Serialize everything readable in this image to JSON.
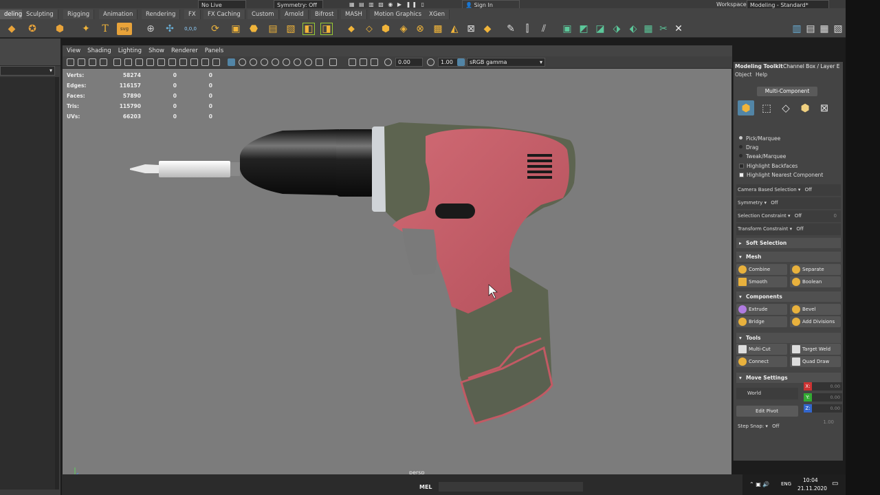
{
  "status_strip": {
    "live_surface": "No Live Surface",
    "symmetry": "Symmetry: Off",
    "sign_in": "Sign In",
    "workspace_label": "Workspace :",
    "workspace_value": "Modeling - Standard*"
  },
  "shelf_tabs": [
    "deling",
    "Sculpting",
    "Rigging",
    "Animation",
    "Rendering",
    "FX",
    "FX Caching",
    "Custom",
    "Arnold",
    "Bifrost",
    "MASH",
    "Motion Graphics",
    "XGen"
  ],
  "shelf_icons": {
    "svg_label": "svg",
    "text_label": "T",
    "coords_label": "0,0,0"
  },
  "viewport": {
    "menu": [
      "View",
      "Shading",
      "Lighting",
      "Show",
      "Renderer",
      "Panels"
    ],
    "field_exposure": "0.00",
    "field_gamma": "1.00",
    "color_space": "sRGB gamma",
    "hud": [
      {
        "label": "Verts:",
        "value": "58274",
        "a": "0",
        "b": "0"
      },
      {
        "label": "Edges:",
        "value": "116157",
        "a": "0",
        "b": "0"
      },
      {
        "label": "Faces:",
        "value": "57890",
        "a": "0",
        "b": "0"
      },
      {
        "label": "Tris:",
        "value": "115790",
        "a": "0",
        "b": "0"
      },
      {
        "label": "UVs:",
        "value": "66203",
        "a": "0",
        "b": "0"
      }
    ],
    "camera": "persp"
  },
  "right_panel": {
    "tab_modeling": "Modeling Toolkit",
    "tab_channel": "Channel Box / Layer E",
    "sub_object": "Object",
    "sub_help": "Help",
    "multi_component": "Multi-Component",
    "pick_marquee": "Pick/Marquee",
    "drag": "Drag",
    "tweak_marquee": "Tweak/Marquee",
    "highlight_backfaces": "Highlight Backfaces",
    "highlight_nearest": "Highlight Nearest Component",
    "camera_based": "Camera Based Selection",
    "camera_based_val": "Off",
    "symmetry": "Symmetry",
    "symmetry_val": "Off",
    "selection_constraint": "Selection Constraint",
    "selection_constraint_val": "Off",
    "selection_constraint_num": "0",
    "transform_constraint": "Transform Constraint",
    "transform_constraint_val": "Off",
    "soft_selection": "Soft Selection",
    "mesh": "Mesh",
    "combine": "Combine",
    "separate": "Separate",
    "smooth": "Smooth",
    "boolean": "Boolean",
    "components": "Components",
    "extrude": "Extrude",
    "bevel": "Bevel",
    "bridge": "Bridge",
    "add_divisions": "Add Divisions",
    "tools": "Tools",
    "multi_cut": "Multi-Cut",
    "target_weld": "Target Weld",
    "connect": "Connect",
    "quad_draw": "Quad Draw",
    "move_settings": "Move Settings",
    "world": "World",
    "edit_pivot": "Edit Pivot",
    "x_label": "X:",
    "y_label": "Y:",
    "z_label": "Z:",
    "x_val": "0.00",
    "y_val": "0.00",
    "z_val": "0.00",
    "step_snap": "Step Snap:",
    "step_snap_val": "Off",
    "step_snap_num": "1.00"
  },
  "bottom": {
    "mel": "MEL",
    "lang": "ENG",
    "time": "10:04",
    "date": "21.11.2020"
  },
  "colors": {
    "accent_blue": "#5285a6",
    "viewport_bg": "#7c7c7c",
    "drill_body_green": "#5d6450",
    "drill_grip_red": "#c25a64",
    "drill_chuck_black": "#1a1a1a"
  }
}
